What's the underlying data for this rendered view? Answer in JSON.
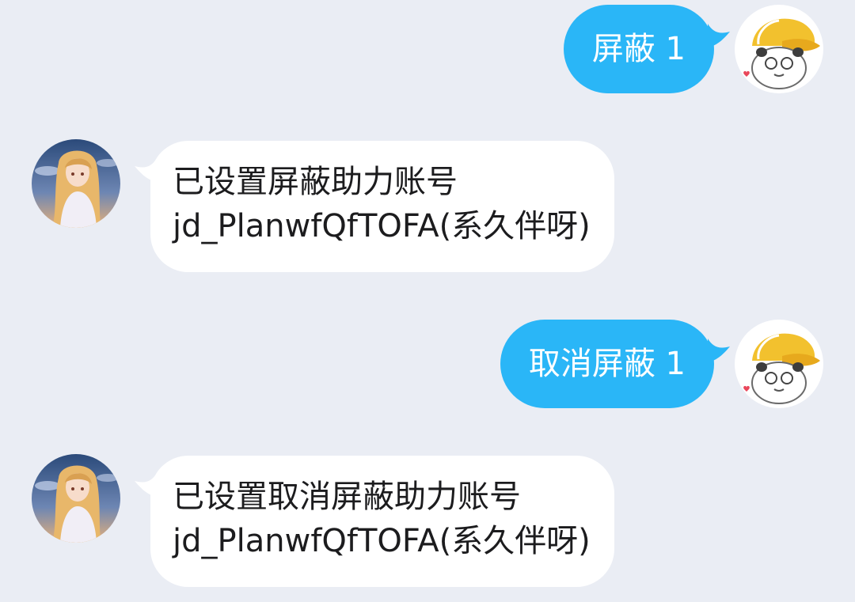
{
  "conversation": {
    "messages": [
      {
        "direction": "outgoing",
        "sender": "self",
        "lines": [
          "屏蔽 1"
        ]
      },
      {
        "direction": "incoming",
        "sender": "bot",
        "lines": [
          "已设置屏蔽助力账号",
          "jd_PlanwfQfTOFA(系久伴呀)"
        ]
      },
      {
        "direction": "outgoing",
        "sender": "self",
        "lines": [
          "取消屏蔽 1"
        ]
      },
      {
        "direction": "incoming",
        "sender": "bot",
        "lines": [
          "已设置取消屏蔽助力账号",
          "jd_PlanwfQfTOFA(系久伴呀)"
        ]
      }
    ]
  },
  "colors": {
    "background": "#eaedf4",
    "outgoing_bubble": "#2ab6f7",
    "outgoing_text": "#ffffff",
    "incoming_bubble": "#ffffff",
    "incoming_text": "#1c1c1e"
  },
  "icons": {
    "self_avatar": "cartoon-bear-with-yellow-cap-avatar",
    "bot_avatar": "anime-girl-portrait-avatar"
  }
}
